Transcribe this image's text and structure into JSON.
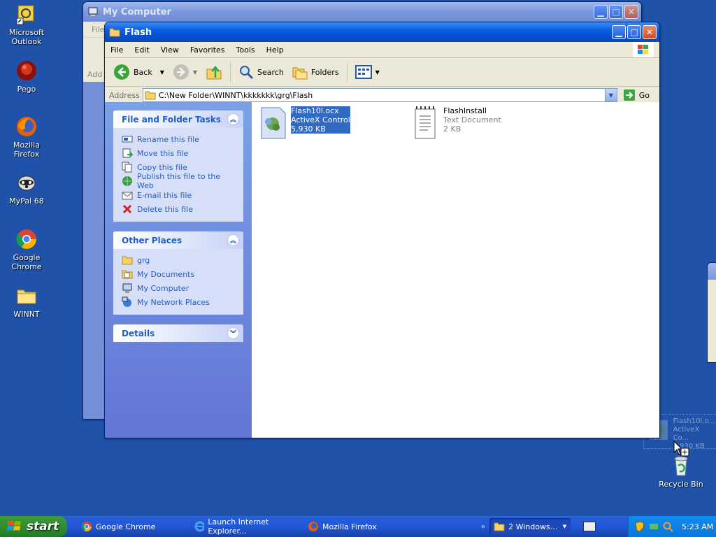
{
  "desktop": {
    "icons": [
      {
        "label": "Microsoft\nOutlook",
        "icon": "outlook-icon"
      },
      {
        "label": "Pego",
        "icon": "pego-icon"
      },
      {
        "label": "Mozilla Firefox",
        "icon": "firefox-icon"
      },
      {
        "label": "MyPal 68",
        "icon": "mypal-icon"
      },
      {
        "label": "Google Chrome",
        "icon": "chrome-icon"
      },
      {
        "label": "WINNT",
        "icon": "folder-icon"
      },
      {
        "label": "Recycle Bin",
        "icon": "recycle-bin-icon"
      }
    ],
    "drag_ghost": {
      "name": "Flash10l.o...",
      "type": "ActiveX Co...",
      "size": "5,930 KB"
    }
  },
  "background_window": {
    "title": "My Computer",
    "menu_first": "File",
    "address_label": "Add"
  },
  "window": {
    "title": "Flash",
    "menu": [
      "File",
      "Edit",
      "View",
      "Favorites",
      "Tools",
      "Help"
    ],
    "toolbar": {
      "back": "Back",
      "search": "Search",
      "folders": "Folders"
    },
    "address": {
      "label": "Address",
      "path": "C:\\New Folder\\WINNT\\kkkkkkk\\grg\\Flash",
      "go": "Go"
    },
    "file_tasks": {
      "title": "File and Folder Tasks",
      "items": [
        {
          "label": "Rename this file",
          "icon": "rename-icon"
        },
        {
          "label": "Move this file",
          "icon": "move-icon"
        },
        {
          "label": "Copy this file",
          "icon": "copy-icon"
        },
        {
          "label": "Publish this file to the Web",
          "icon": "publish-web-icon"
        },
        {
          "label": "E-mail this file",
          "icon": "email-icon"
        },
        {
          "label": "Delete this file",
          "icon": "delete-icon"
        }
      ]
    },
    "other_places": {
      "title": "Other Places",
      "items": [
        {
          "label": "grg",
          "icon": "folder-icon"
        },
        {
          "label": "My Documents",
          "icon": "my-documents-icon"
        },
        {
          "label": "My Computer",
          "icon": "my-computer-icon"
        },
        {
          "label": "My Network Places",
          "icon": "network-places-icon"
        }
      ]
    },
    "details": {
      "title": "Details"
    },
    "files": [
      {
        "name": "Flash10l.ocx",
        "type": "ActiveX Control",
        "size": "5,930 KB",
        "selected": true,
        "icon": "activex-icon"
      },
      {
        "name": "FlashInstall",
        "type": "Text Document",
        "size": "2 KB",
        "selected": false,
        "icon": "text-document-icon"
      }
    ]
  },
  "taskbar": {
    "start": "start",
    "items": [
      {
        "label": "Google Chrome",
        "icon": "chrome-icon"
      },
      {
        "label": "Launch Internet Explorer...",
        "icon": "ie-icon"
      },
      {
        "label": "Mozilla Firefox",
        "icon": "firefox-icon"
      },
      {
        "label": "2 Windows...",
        "icon": "folder-icon"
      }
    ],
    "clock": "5:23 AM"
  },
  "colors": {
    "desktop": "#1f52a8",
    "selection": "#316ac5",
    "link": "#215dc6"
  }
}
